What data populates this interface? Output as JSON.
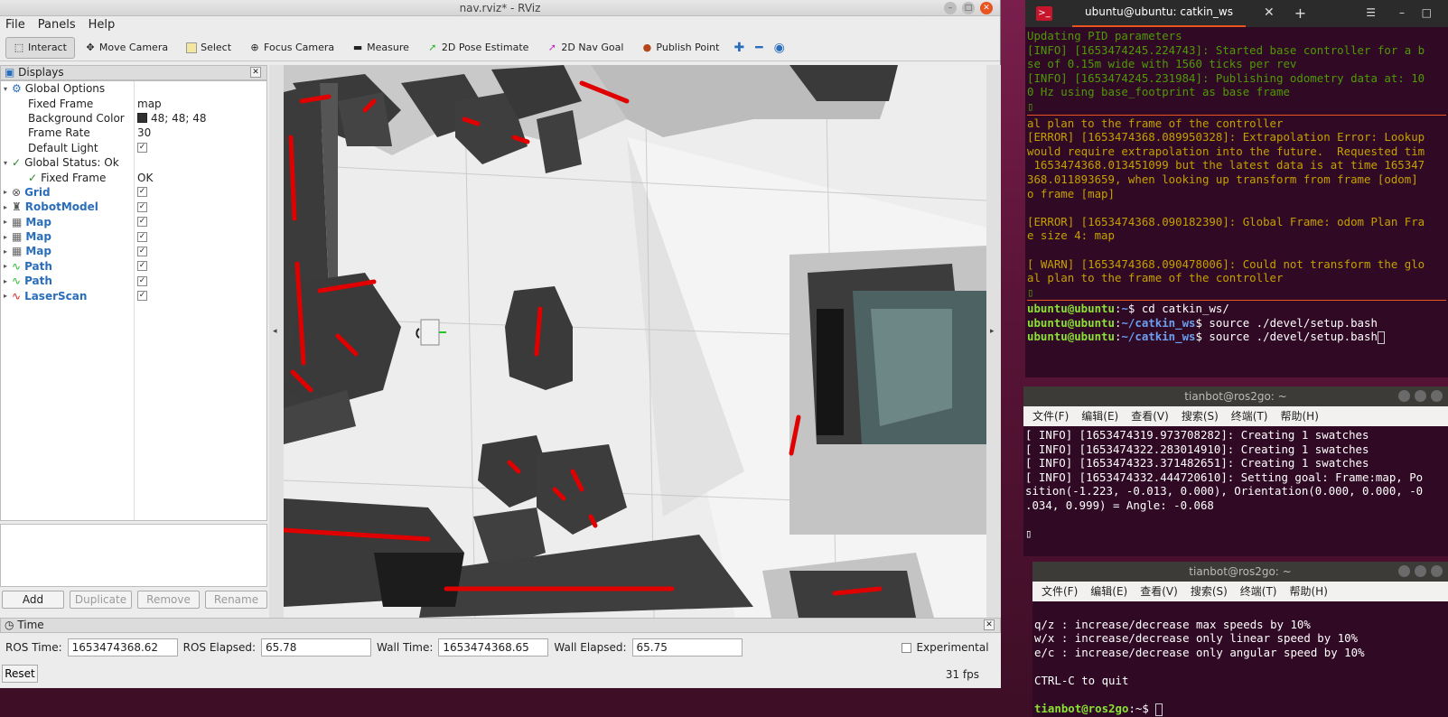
{
  "rviz": {
    "title": "nav.rviz* - RViz",
    "menu": [
      "File",
      "Panels",
      "Help"
    ],
    "toolbar": [
      {
        "label": "Interact",
        "icon": "interact-icon",
        "active": true
      },
      {
        "label": "Move Camera",
        "icon": "move-camera-icon"
      },
      {
        "label": "Select",
        "icon": "select-icon"
      },
      {
        "label": "Focus Camera",
        "icon": "focus-camera-icon"
      },
      {
        "label": "Measure",
        "icon": "measure-icon"
      },
      {
        "label": "2D Pose Estimate",
        "icon": "pose-estimate-icon"
      },
      {
        "label": "2D Nav Goal",
        "icon": "nav-goal-icon"
      },
      {
        "label": "Publish Point",
        "icon": "publish-point-icon"
      }
    ],
    "displays": {
      "header": "Displays",
      "rows": [
        {
          "indent": 0,
          "arrow": "▾",
          "icon": "gear-icon",
          "name": "Global Options",
          "value": ""
        },
        {
          "indent": 1,
          "arrow": "",
          "icon": "",
          "name": "Fixed Frame",
          "value": "map"
        },
        {
          "indent": 1,
          "arrow": "",
          "icon": "",
          "name": "Background Color",
          "value": "48; 48; 48",
          "swatch": true
        },
        {
          "indent": 1,
          "arrow": "",
          "icon": "",
          "name": "Frame Rate",
          "value": "30"
        },
        {
          "indent": 1,
          "arrow": "",
          "icon": "",
          "name": "Default Light",
          "value": "",
          "check": true
        },
        {
          "indent": 0,
          "arrow": "▾",
          "icon": "checkmark-icon",
          "name": "Global Status: Ok",
          "value": ""
        },
        {
          "indent": 1,
          "arrow": "",
          "icon": "checkmark-icon",
          "name": "Fixed Frame",
          "value": "OK"
        },
        {
          "indent": 0,
          "arrow": "▸",
          "icon": "grid-icon",
          "name": "Grid",
          "value": "",
          "check": true,
          "blue": true
        },
        {
          "indent": 0,
          "arrow": "▸",
          "icon": "robot-model-icon",
          "name": "RobotModel",
          "value": "",
          "check": true,
          "blue": true
        },
        {
          "indent": 0,
          "arrow": "▸",
          "icon": "map-icon",
          "name": "Map",
          "value": "",
          "check": true,
          "blue": true
        },
        {
          "indent": 0,
          "arrow": "▸",
          "icon": "map-icon",
          "name": "Map",
          "value": "",
          "check": true,
          "blue": true
        },
        {
          "indent": 0,
          "arrow": "▸",
          "icon": "map-icon",
          "name": "Map",
          "value": "",
          "check": true,
          "blue": true
        },
        {
          "indent": 0,
          "arrow": "▸",
          "icon": "path-icon",
          "name": "Path",
          "value": "",
          "check": true,
          "blue": true
        },
        {
          "indent": 0,
          "arrow": "▸",
          "icon": "path-icon",
          "name": "Path",
          "value": "",
          "check": true,
          "blue": true
        },
        {
          "indent": 0,
          "arrow": "▸",
          "icon": "laserscan-icon",
          "name": "LaserScan",
          "value": "",
          "check": true,
          "blue": true
        }
      ],
      "buttons": {
        "add": "Add",
        "duplicate": "Duplicate",
        "remove": "Remove",
        "rename": "Rename"
      }
    },
    "time": {
      "header": "Time",
      "ros_time_label": "ROS Time:",
      "ros_time": "1653474368.62",
      "ros_elapsed_label": "ROS Elapsed:",
      "ros_elapsed": "65.78",
      "wall_time_label": "Wall Time:",
      "wall_time": "1653474368.65",
      "wall_elapsed_label": "Wall Elapsed:",
      "wall_elapsed": "65.75",
      "experimental": "Experimental",
      "reset": "Reset",
      "fps": "31 fps"
    }
  },
  "terminal1": {
    "tab_title": "ubuntu@ubuntu: catkin_ws",
    "lines": [
      {
        "t": "Updating PID parameters",
        "c": "c-green"
      },
      {
        "t": "[INFO] [1653474245.224743]: Started base controller for a b",
        "c": "c-green"
      },
      {
        "t": "se of 0.15m wide with 1560 ticks per rev",
        "c": "c-green"
      },
      {
        "t": "[INFO] [1653474245.231984]: Publishing odometry data at: 10",
        "c": "c-green"
      },
      {
        "t": "0 Hz using base_footprint as base frame",
        "c": "c-green"
      },
      {
        "t": "▯",
        "c": "c-green"
      },
      {
        "t": "---",
        "c": "sep"
      },
      {
        "t": "al plan to the frame of the controller",
        "c": "c-ylw"
      },
      {
        "t": "[ERROR] [1653474368.089950328]: Extrapolation Error: Lookup",
        "c": "c-ylw"
      },
      {
        "t": "would require extrapolation into the future.  Requested tim",
        "c": "c-ylw"
      },
      {
        "t": " 1653474368.013451099 but the latest data is at time 165347",
        "c": "c-ylw"
      },
      {
        "t": "368.011893659, when looking up transform from frame [odom]",
        "c": "c-ylw"
      },
      {
        "t": "o frame [map]",
        "c": "c-ylw"
      },
      {
        "t": "",
        "c": "c-ylw"
      },
      {
        "t": "[ERROR] [1653474368.090182390]: Global Frame: odom Plan Fra",
        "c": "c-ylw"
      },
      {
        "t": "e size 4: map",
        "c": "c-ylw"
      },
      {
        "t": "",
        "c": "c-ylw"
      },
      {
        "t": "[ WARN] [1653474368.090478006]: Could not transform the glo",
        "c": "c-ylw"
      },
      {
        "t": "al plan to the frame of the controller",
        "c": "c-ylw"
      },
      {
        "t": "▯",
        "c": "c-green"
      },
      {
        "t": "---",
        "c": "sep"
      }
    ],
    "prompts": [
      {
        "user": "ubuntu@ubuntu",
        "path": "~",
        "cmd": "$ cd catkin_ws/"
      },
      {
        "user": "ubuntu@ubuntu",
        "path": "~/catkin_ws",
        "cmd": "$ source ./devel/setup.bash"
      },
      {
        "user": "ubuntu@ubuntu",
        "path": "~/catkin_ws",
        "cmd": "$ source ./devel/setup.bash"
      }
    ]
  },
  "terminal2": {
    "title": "tianbot@ros2go: ~",
    "menu": [
      "文件(F)",
      "编辑(E)",
      "查看(V)",
      "搜索(S)",
      "终端(T)",
      "帮助(H)"
    ],
    "lines": [
      "[ INFO] [1653474319.973708282]: Creating 1 swatches",
      "[ INFO] [1653474322.283014910]: Creating 1 swatches",
      "[ INFO] [1653474323.371482651]: Creating 1 swatches",
      "[ INFO] [1653474332.444720610]: Setting goal: Frame:map, Po",
      "sition(-1.223, -0.013, 0.000), Orientation(0.000, 0.000, -0",
      ".034, 0.999) = Angle: -0.068",
      "",
      "▯"
    ]
  },
  "terminal3": {
    "title": "tianbot@ros2go: ~",
    "menu": [
      "文件(F)",
      "编辑(E)",
      "查看(V)",
      "搜索(S)",
      "终端(T)",
      "帮助(H)"
    ],
    "lines": [
      "",
      "q/z : increase/decrease max speeds by 10%",
      "w/x : increase/decrease only linear speed by 10%",
      "e/c : increase/decrease only angular speed by 10%",
      "",
      "CTRL-C to quit",
      ""
    ],
    "prompt_user": "tianbot@ros2go",
    "prompt_rest": ":~$ "
  }
}
